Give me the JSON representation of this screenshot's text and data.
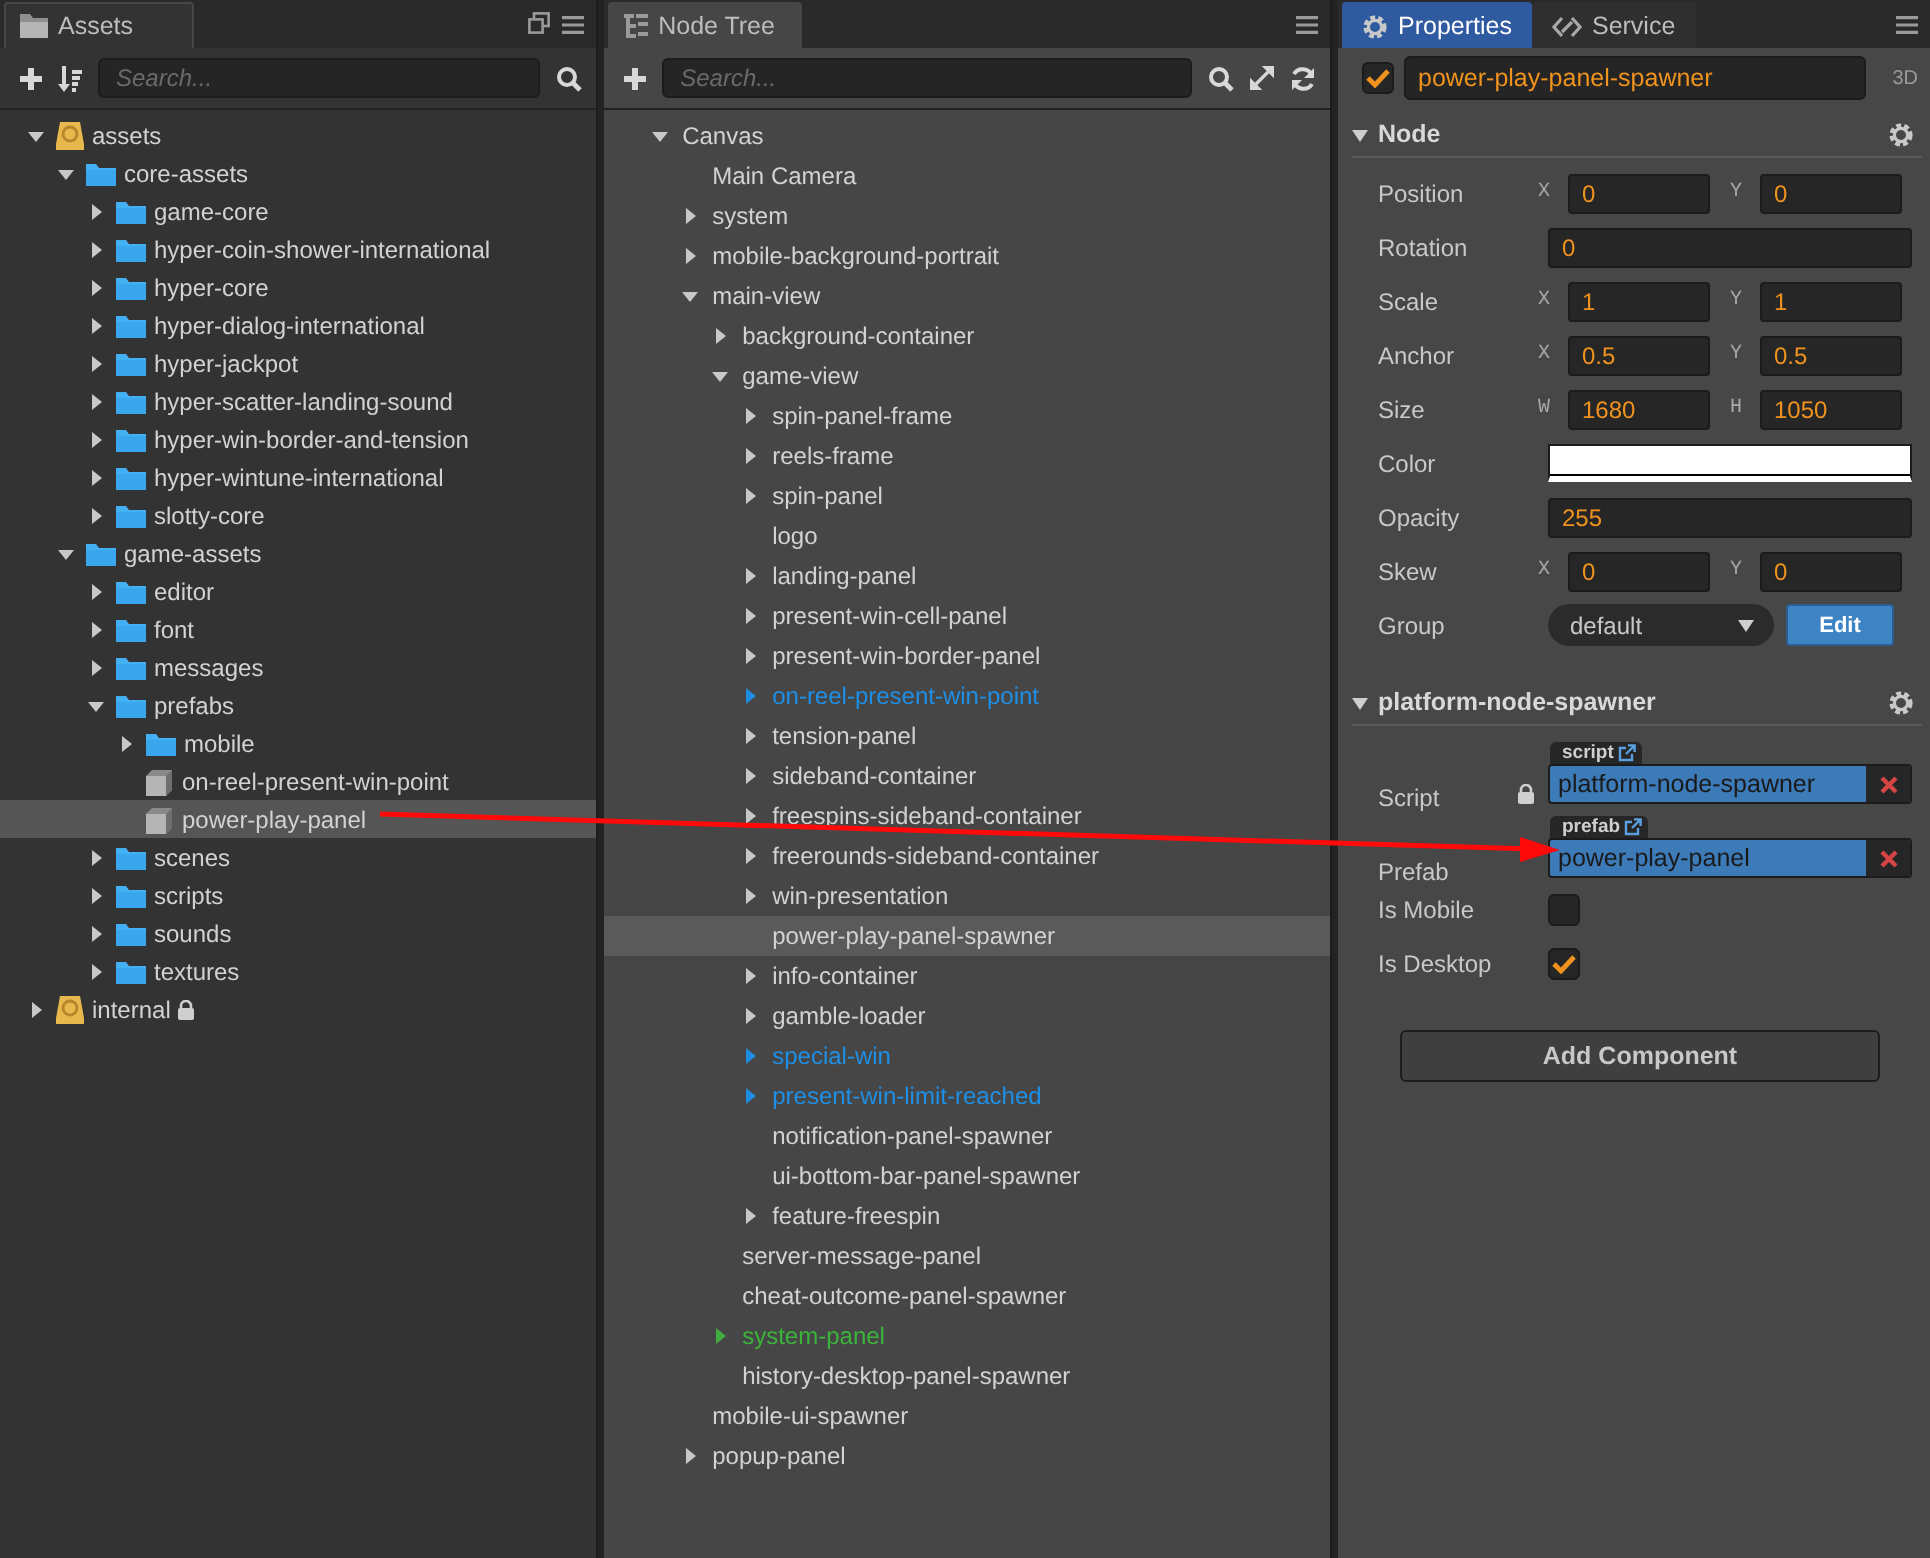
{
  "assets_panel": {
    "tab": "Assets",
    "search": {
      "placeholder": "Search..."
    },
    "tree": [
      {
        "label": "assets",
        "kind": "root",
        "expanded": true,
        "selected": false,
        "children": [
          {
            "label": "core-assets",
            "kind": "folder",
            "expanded": true,
            "selected": false,
            "children": [
              {
                "label": "game-core",
                "kind": "folder",
                "expanded": false,
                "selected": false
              },
              {
                "label": "hyper-coin-shower-international",
                "kind": "folder",
                "expanded": false,
                "selected": false
              },
              {
                "label": "hyper-core",
                "kind": "folder",
                "expanded": false,
                "selected": false
              },
              {
                "label": "hyper-dialog-international",
                "kind": "folder",
                "expanded": false,
                "selected": false
              },
              {
                "label": "hyper-jackpot",
                "kind": "folder",
                "expanded": false,
                "selected": false
              },
              {
                "label": "hyper-scatter-landing-sound",
                "kind": "folder",
                "expanded": false,
                "selected": false
              },
              {
                "label": "hyper-win-border-and-tension",
                "kind": "folder",
                "expanded": false,
                "selected": false
              },
              {
                "label": "hyper-wintune-international",
                "kind": "folder",
                "expanded": false,
                "selected": false
              },
              {
                "label": "slotty-core",
                "kind": "folder",
                "expanded": false,
                "selected": false
              }
            ]
          },
          {
            "label": "game-assets",
            "kind": "folder",
            "expanded": true,
            "selected": false,
            "children": [
              {
                "label": "editor",
                "kind": "folder",
                "expanded": false,
                "selected": false
              },
              {
                "label": "font",
                "kind": "folder",
                "expanded": false,
                "selected": false
              },
              {
                "label": "messages",
                "kind": "folder",
                "expanded": false,
                "selected": false
              },
              {
                "label": "prefabs",
                "kind": "folder",
                "expanded": true,
                "selected": false,
                "children": [
                  {
                    "label": "mobile",
                    "kind": "folder",
                    "expanded": false,
                    "selected": false
                  },
                  {
                    "label": "on-reel-present-win-point",
                    "kind": "prefab",
                    "selected": false
                  },
                  {
                    "label": "power-play-panel",
                    "kind": "prefab",
                    "selected": true
                  }
                ]
              },
              {
                "label": "scenes",
                "kind": "folder",
                "expanded": false,
                "selected": false
              },
              {
                "label": "scripts",
                "kind": "folder",
                "expanded": false,
                "selected": false
              },
              {
                "label": "sounds",
                "kind": "folder",
                "expanded": false,
                "selected": false
              },
              {
                "label": "textures",
                "kind": "folder",
                "expanded": false,
                "selected": false
              }
            ]
          }
        ]
      },
      {
        "label": "internal",
        "kind": "root",
        "expanded": false,
        "selected": false,
        "locked": true
      }
    ]
  },
  "node_tree_panel": {
    "tab": "Node Tree",
    "search": {
      "placeholder": "Search..."
    },
    "tree": [
      {
        "label": "Canvas",
        "kind": "node",
        "expanded": true,
        "selected": false,
        "children": [
          {
            "label": "Main Camera",
            "kind": "node",
            "selected": false
          },
          {
            "label": "system",
            "kind": "node",
            "expanded": false,
            "selected": false
          },
          {
            "label": "mobile-background-portrait",
            "kind": "node",
            "expanded": false,
            "selected": false
          },
          {
            "label": "main-view",
            "kind": "node",
            "expanded": true,
            "selected": false,
            "children": [
              {
                "label": "background-container",
                "kind": "node",
                "expanded": false,
                "selected": false
              },
              {
                "label": "game-view",
                "kind": "node",
                "expanded": true,
                "selected": false,
                "children": [
                  {
                    "label": "spin-panel-frame",
                    "kind": "node",
                    "expanded": false,
                    "selected": false
                  },
                  {
                    "label": "reels-frame",
                    "kind": "node",
                    "expanded": false,
                    "selected": false
                  },
                  {
                    "label": "spin-panel",
                    "kind": "node",
                    "expanded": false,
                    "selected": false
                  },
                  {
                    "label": "logo",
                    "kind": "node",
                    "selected": false
                  },
                  {
                    "label": "landing-panel",
                    "kind": "node",
                    "expanded": false,
                    "selected": false
                  },
                  {
                    "label": "present-win-cell-panel",
                    "kind": "node",
                    "expanded": false,
                    "selected": false
                  },
                  {
                    "label": "present-win-border-panel",
                    "kind": "node",
                    "expanded": false,
                    "selected": false
                  },
                  {
                    "label": "on-reel-present-win-point",
                    "kind": "prefab",
                    "expanded": false,
                    "selected": false
                  },
                  {
                    "label": "tension-panel",
                    "kind": "node",
                    "expanded": false,
                    "selected": false
                  },
                  {
                    "label": "sideband-container",
                    "kind": "node",
                    "expanded": false,
                    "selected": false
                  },
                  {
                    "label": "freespins-sideband-container",
                    "kind": "node",
                    "expanded": false,
                    "selected": false
                  },
                  {
                    "label": "freerounds-sideband-container",
                    "kind": "node",
                    "expanded": false,
                    "selected": false
                  },
                  {
                    "label": "win-presentation",
                    "kind": "node",
                    "expanded": false,
                    "selected": false
                  },
                  {
                    "label": "power-play-panel-spawner",
                    "kind": "node",
                    "selected": true
                  },
                  {
                    "label": "info-container",
                    "kind": "node",
                    "expanded": false,
                    "selected": false
                  },
                  {
                    "label": "gamble-loader",
                    "kind": "node",
                    "expanded": false,
                    "selected": false
                  },
                  {
                    "label": "special-win",
                    "kind": "prefab",
                    "expanded": false,
                    "selected": false
                  },
                  {
                    "label": "present-win-limit-reached",
                    "kind": "prefab",
                    "expanded": false,
                    "selected": false
                  },
                  {
                    "label": "notification-panel-spawner",
                    "kind": "node",
                    "selected": false
                  },
                  {
                    "label": "ui-bottom-bar-panel-spawner",
                    "kind": "node",
                    "selected": false
                  },
                  {
                    "label": "feature-freespin",
                    "kind": "node",
                    "expanded": false,
                    "selected": false
                  }
                ]
              },
              {
                "label": "server-message-panel",
                "kind": "node",
                "selected": false
              },
              {
                "label": "cheat-outcome-panel-spawner",
                "kind": "node",
                "selected": false
              },
              {
                "label": "system-panel",
                "kind": "synced",
                "expanded": false,
                "selected": false
              },
              {
                "label": "history-desktop-panel-spawner",
                "kind": "node",
                "selected": false
              }
            ]
          },
          {
            "label": "mobile-ui-spawner",
            "kind": "node",
            "selected": false
          },
          {
            "label": "popup-panel",
            "kind": "node",
            "expanded": false,
            "selected": false
          }
        ]
      }
    ]
  },
  "properties_panel": {
    "tabs": [
      {
        "label": "Properties",
        "kind": "gear",
        "selected": true
      },
      {
        "label": "Service",
        "kind": "service",
        "selected": false
      }
    ],
    "node": {
      "active": true,
      "name": "power-play-panel-spawner",
      "mode": "3D"
    },
    "sections": [
      {
        "title": "Node",
        "expanded": true,
        "rows": [
          {
            "kind": "pair",
            "label": "Position",
            "fields": [
              {
                "axis": "X",
                "value": "0"
              },
              {
                "axis": "Y",
                "value": "0"
              }
            ]
          },
          {
            "kind": "single",
            "label": "Rotation",
            "value": "0"
          },
          {
            "kind": "pair",
            "label": "Scale",
            "fields": [
              {
                "axis": "X",
                "value": "1"
              },
              {
                "axis": "Y",
                "value": "1"
              }
            ]
          },
          {
            "kind": "pair",
            "label": "Anchor",
            "fields": [
              {
                "axis": "X",
                "value": "0.5"
              },
              {
                "axis": "Y",
                "value": "0.5"
              }
            ]
          },
          {
            "kind": "pair",
            "label": "Size",
            "fields": [
              {
                "axis": "W",
                "value": "1680"
              },
              {
                "axis": "H",
                "value": "1050"
              }
            ]
          },
          {
            "kind": "color",
            "label": "Color",
            "color": "#ffffff"
          },
          {
            "kind": "single",
            "label": "Opacity",
            "value": "255"
          },
          {
            "kind": "pair",
            "label": "Skew",
            "fields": [
              {
                "axis": "X",
                "value": "0"
              },
              {
                "axis": "Y",
                "value": "0"
              }
            ]
          },
          {
            "kind": "select",
            "label": "Group",
            "value": "default",
            "button": "Edit"
          }
        ]
      },
      {
        "title": "platform-node-spawner",
        "expanded": true,
        "rows": [
          {
            "kind": "asset",
            "label": "Script",
            "tag": "script",
            "value": "platform-node-spawner",
            "locked": true
          },
          {
            "kind": "asset",
            "label": "Prefab",
            "tag": "prefab",
            "value": "power-play-panel",
            "locked": false
          },
          {
            "kind": "checkbox",
            "label": "Is Mobile",
            "checked": false
          },
          {
            "kind": "checkbox",
            "label": "Is Desktop",
            "checked": true
          }
        ]
      }
    ],
    "add_button": "Add Component"
  }
}
